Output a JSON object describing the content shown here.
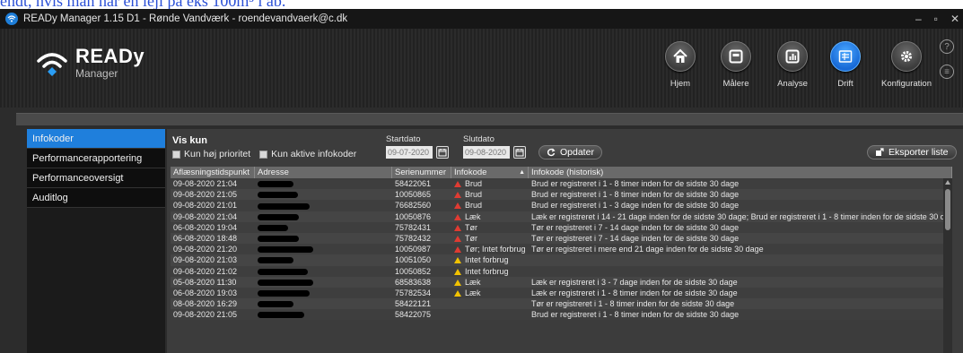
{
  "caption": "endt, hvis man har en lejl på eks 100m³ i ab.",
  "window": {
    "title": "READy Manager 1.15 D1 - Rønde Vandværk - roendevandvaerk@c.dk",
    "minimize": "–",
    "maximize": "▫",
    "close": "✕"
  },
  "logo": {
    "title": "READy",
    "subtitle": "Manager"
  },
  "nav": [
    {
      "label": "Hjem",
      "icon": "home-icon"
    },
    {
      "label": "Målere",
      "icon": "meter-icon"
    },
    {
      "label": "Analyse",
      "icon": "chart-icon"
    },
    {
      "label": "Drift",
      "icon": "operations-icon",
      "active": true
    },
    {
      "label": "Konfiguration",
      "icon": "gear-icon"
    }
  ],
  "help": {
    "question": "?",
    "chat": "≡"
  },
  "sidebar": {
    "items": [
      {
        "label": "Infokoder",
        "active": true
      },
      {
        "label": "Performancerapportering"
      },
      {
        "label": "Performanceoversigt"
      },
      {
        "label": "Auditlog"
      }
    ]
  },
  "filters": {
    "title": "Vis kun",
    "high_priority": "Kun høj prioritet",
    "active_codes": "Kun aktive infokoder",
    "start_label": "Startdato",
    "start_value": "09-07-2020",
    "end_label": "Slutdato",
    "end_value": "09-08-2020",
    "update_label": "Opdater",
    "export_label": "Eksporter liste"
  },
  "table": {
    "columns": [
      "Aflæsningstidspunkt",
      "Adresse",
      "Serienummer",
      "Infokode",
      "Infokode (historisk)"
    ],
    "rows": [
      {
        "time": "09-08-2020 21:04",
        "serial": "58422061",
        "code": "Brud",
        "level": "red",
        "history": "Brud er registreret i 1 - 8 timer inden for de sidste 30 dage"
      },
      {
        "time": "09-08-2020 21:05",
        "serial": "10050865",
        "code": "Brud",
        "level": "red",
        "history": "Brud er registreret i 1 - 8 timer inden for de sidste 30 dage"
      },
      {
        "time": "09-08-2020 21:01",
        "serial": "76682560",
        "code": "Brud",
        "level": "red",
        "history": "Brud er registreret i 1 - 3 dage inden for de sidste 30 dage"
      },
      {
        "time": "09-08-2020 21:04",
        "serial": "10050876",
        "code": "Læk",
        "level": "red",
        "history": "Læk er registreret i 14 - 21 dage inden for de sidste 30 dage; Brud er registreret i 1 - 8 timer inden for de sidste 30 dage"
      },
      {
        "time": "06-08-2020 19:04",
        "serial": "75782431",
        "code": "Tør",
        "level": "red",
        "history": "Tør er registreret i 7 - 14 dage inden for de sidste 30 dage"
      },
      {
        "time": "06-08-2020 18:48",
        "serial": "75782432",
        "code": "Tør",
        "level": "red",
        "history": "Tør er registreret i 7 - 14 dage inden for de sidste 30 dage"
      },
      {
        "time": "09-08-2020 21:20",
        "serial": "10050987",
        "code": "Tør; Intet forbrug",
        "level": "red",
        "history": "Tør er registreret i mere end 21 dage inden for de sidste 30 dage"
      },
      {
        "time": "09-08-2020 21:03",
        "serial": "10051050",
        "code": "Intet forbrug",
        "level": "yellow",
        "history": ""
      },
      {
        "time": "09-08-2020 21:02",
        "serial": "10050852",
        "code": "Intet forbrug",
        "level": "yellow",
        "history": ""
      },
      {
        "time": "05-08-2020 11:30",
        "serial": "68583638",
        "code": "Læk",
        "level": "yellow",
        "history": "Læk er registreret i 3 - 7 dage inden for de sidste 30 dage"
      },
      {
        "time": "06-08-2020 19:03",
        "serial": "75782534",
        "code": "Læk",
        "level": "yellow",
        "history": "Læk er registreret i 1 - 8 timer inden for de sidste 30 dage"
      },
      {
        "time": "08-08-2020 16:29",
        "serial": "58422121",
        "code": "",
        "level": "",
        "history": "Tør er registreret i 1 - 8 timer inden for de sidste 30 dage"
      },
      {
        "time": "09-08-2020 21:05",
        "serial": "58422075",
        "code": "",
        "level": "",
        "history": "Brud er registreret i 1 - 8 timer inden for de sidste 30 dage"
      }
    ]
  },
  "colors": {
    "accent": "#1f7fdc",
    "alert_red": "#e03b32",
    "alert_yellow": "#f2c200"
  }
}
